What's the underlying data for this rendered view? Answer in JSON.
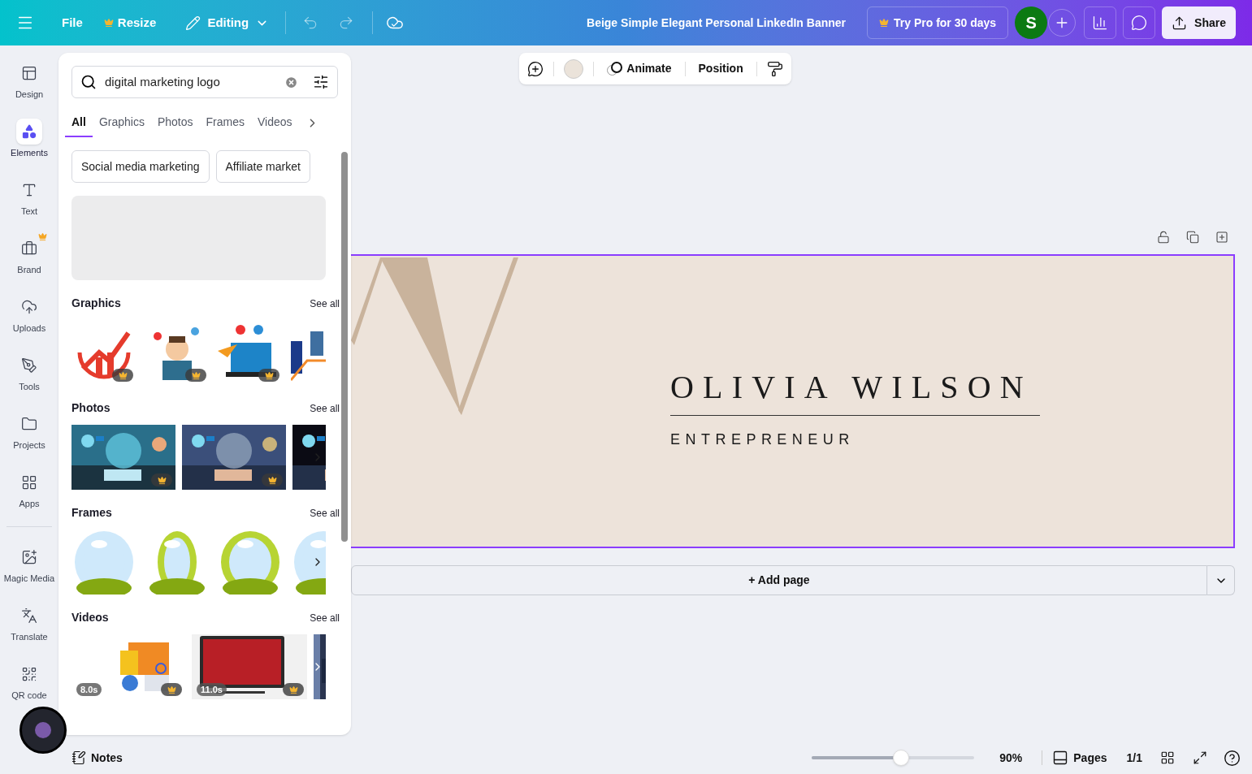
{
  "top_bar": {
    "menu": [
      {
        "label": "File",
        "pro": false
      },
      {
        "label": "Resize",
        "pro": true
      }
    ],
    "mode": "Editing",
    "title": "Beige Simple Elegant Personal LinkedIn Banner",
    "try_pro": "Try Pro for 30 days",
    "avatar": "S",
    "share": "Share"
  },
  "sidebar": {
    "items": [
      {
        "label": "Design",
        "selected": false,
        "pro": false
      },
      {
        "label": "Elements",
        "selected": true,
        "pro": false
      },
      {
        "label": "Text",
        "selected": false,
        "pro": false
      },
      {
        "label": "Brand",
        "selected": false,
        "pro": true
      },
      {
        "label": "Uploads",
        "selected": false,
        "pro": false
      },
      {
        "label": "Tools",
        "selected": false,
        "pro": false
      },
      {
        "label": "Projects",
        "selected": false,
        "pro": false
      },
      {
        "label": "Apps",
        "selected": false,
        "pro": false
      }
    ],
    "extra_items": [
      {
        "label": "Magic Media",
        "selected": false
      },
      {
        "label": "Translate",
        "selected": false
      },
      {
        "label": "QR code",
        "selected": false
      }
    ]
  },
  "panel": {
    "search": {
      "value": "digital marketing logo"
    },
    "tabs": [
      {
        "label": "All",
        "selected": true
      },
      {
        "label": "Graphics",
        "selected": false
      },
      {
        "label": "Photos",
        "selected": false
      },
      {
        "label": "Frames",
        "selected": false
      },
      {
        "label": "Videos",
        "selected": false
      }
    ],
    "suggestions": [
      "Social media marketing",
      "Affiliate market"
    ],
    "sections": [
      {
        "kind": "graphics",
        "title": "Graphics",
        "see_all": "See all",
        "items": [
          {
            "premium": true
          },
          {
            "premium": true
          },
          {
            "premium": true
          },
          {
            "premium": false
          }
        ]
      },
      {
        "kind": "photos",
        "title": "Photos",
        "see_all": "See all",
        "items": [
          {
            "premium": true
          },
          {
            "premium": true
          },
          {
            "premium": false
          }
        ]
      },
      {
        "kind": "frames",
        "title": "Frames",
        "see_all": "See all",
        "items": [
          {
            "premium": false
          },
          {
            "premium": false
          },
          {
            "premium": false
          },
          {
            "premium": false
          }
        ]
      },
      {
        "kind": "videos",
        "title": "Videos",
        "see_all": "See all",
        "items": [
          {
            "premium": true,
            "duration": "8.0s"
          },
          {
            "premium": true,
            "duration": "11.0s"
          },
          {
            "premium": false
          }
        ]
      }
    ]
  },
  "toolbar": {
    "color": "#ebe3da",
    "buttons": [
      "Animate",
      "Position"
    ]
  },
  "banner": {
    "name": "OLIVIA WILSON",
    "role": "ENTREPRENEUR"
  },
  "add_page": "+ Add page",
  "status_bar": {
    "notes": "Notes",
    "zoom": {
      "level": 0.55
    },
    "zoom_value": "90%",
    "pages": "Pages",
    "page_count": "1/1"
  }
}
